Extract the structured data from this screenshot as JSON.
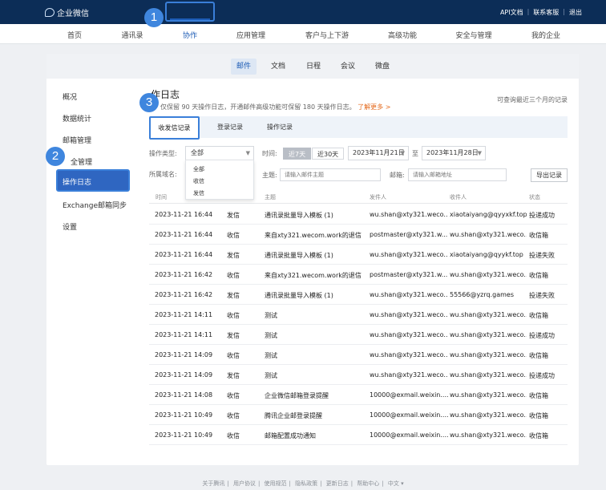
{
  "app": {
    "name": "企业微信",
    "top_links": [
      "API文档",
      "联系客服",
      "退出"
    ]
  },
  "main_nav": {
    "items": [
      "首页",
      "通讯录",
      "协作",
      "应用管理",
      "客户与上下游",
      "高级功能",
      "安全与管理",
      "我的企业"
    ],
    "active_index": 2
  },
  "sub_tabs": {
    "items": [
      "邮件",
      "文档",
      "日程",
      "会议",
      "微盘"
    ],
    "active_index": 0
  },
  "side_menu": {
    "items": [
      "概况",
      "数据统计",
      "邮箱管理",
      "安全管理",
      "操作日志",
      "Exchange邮箱同步",
      "设置"
    ],
    "active_index": 4,
    "partial_label": "全管理"
  },
  "step_badges": [
    "1",
    "2",
    "3"
  ],
  "page": {
    "title": "操作日志",
    "title_visible": "作日志",
    "desc": "仅保留 90 天操作日志，开通邮件高级功能可保留 180 天操作日志。",
    "desc_link": "了解更多 >",
    "note": "可查询最近三个月的记录"
  },
  "log_tabs": {
    "items": [
      "收发信记录",
      "登录记录",
      "操作记录"
    ],
    "active_index": 0
  },
  "filters": {
    "type_label": "操作类型:",
    "type_value": "全部",
    "type_options": [
      "全部",
      "收信",
      "发信"
    ],
    "time_label": "时间:",
    "range_options": [
      "近7天",
      "近30天"
    ],
    "range_active": 0,
    "date_from": "2023年11月21日",
    "date_to_sep": "至",
    "date_to": "2023年11月28日",
    "domain_label": "所属域名:",
    "subject_label": "主题:",
    "subject_placeholder": "请输入邮件主题",
    "mailbox_label": "邮箱:",
    "mailbox_placeholder": "请输入邮箱地址",
    "export_label": "导出记录"
  },
  "table": {
    "headers": [
      "时间",
      "",
      "主题",
      "发件人",
      "收件人",
      "状态"
    ],
    "rows": [
      [
        "2023-11-21 16:44",
        "发信",
        "通讯录批量导入模板 (1)",
        "wu.shan@xty321.weco...",
        "xiaotaiyang@qyyxkf.top",
        "投递成功"
      ],
      [
        "2023-11-21 16:44",
        "收信",
        "来自xty321.wecom.work的退信",
        "postmaster@xty321.w...",
        "wu.shan@xty321.weco...",
        "收信箱"
      ],
      [
        "2023-11-21 16:44",
        "发信",
        "通讯录批量导入模板 (1)",
        "wu.shan@xty321.weco...",
        "xiaotaiyang@qyykf.top",
        "投递失败"
      ],
      [
        "2023-11-21 16:42",
        "收信",
        "来自xty321.wecom.work的退信",
        "postmaster@xty321.w...",
        "wu.shan@xty321.weco...",
        "收信箱"
      ],
      [
        "2023-11-21 16:42",
        "发信",
        "通讯录批量导入模板 (1)",
        "wu.shan@xty321.weco...",
        "55566@yzrq.games",
        "投递失败"
      ],
      [
        "2023-11-21 14:11",
        "收信",
        "测试",
        "wu.shan@xty321.weco...",
        "wu.shan@xty321.weco...",
        "收信箱"
      ],
      [
        "2023-11-21 14:11",
        "发信",
        "测试",
        "wu.shan@xty321.weco...",
        "wu.shan@xty321.weco...",
        "投递成功"
      ],
      [
        "2023-11-21 14:09",
        "收信",
        "测试",
        "wu.shan@xty321.weco...",
        "wu.shan@xty321.weco...",
        "收信箱"
      ],
      [
        "2023-11-21 14:09",
        "发信",
        "测试",
        "wu.shan@xty321.weco...",
        "wu.shan@xty321.weco...",
        "投递成功"
      ],
      [
        "2023-11-21 14:08",
        "收信",
        "企业微信邮箱登录提醒",
        "10000@exmail.weixin....",
        "wu.shan@xty321.weco...",
        "收信箱"
      ],
      [
        "2023-11-21 10:49",
        "收信",
        "腾讯企业邮登录提醒",
        "10000@exmail.weixin....",
        "wu.shan@xty321.weco...",
        "收信箱"
      ],
      [
        "2023-11-21 10:49",
        "收信",
        "邮箱配置成功通知",
        "10000@exmail.weixin....",
        "wu.shan@xty321.weco...",
        "收信箱"
      ]
    ]
  },
  "footer": {
    "links": [
      "关于腾讯",
      "用户协议",
      "使用规范",
      "隐私政策",
      "更新日志",
      "帮助中心",
      "中文 ▾"
    ]
  },
  "colors": {
    "topbar": "#0c2d57",
    "accent": "#2f66c1",
    "highlight": "#3a7fd9",
    "link": "#e4691c"
  }
}
